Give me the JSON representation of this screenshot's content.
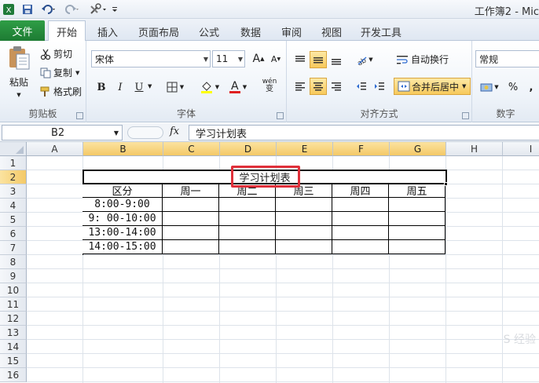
{
  "titlebar": {
    "title": "工作簿2 - Mic"
  },
  "tabs": {
    "file": "文件",
    "items": [
      "开始",
      "插入",
      "页面布局",
      "公式",
      "数据",
      "审阅",
      "视图",
      "开发工具"
    ]
  },
  "ribbon": {
    "clipboard": {
      "label": "剪贴板",
      "paste": "粘贴",
      "cut": "剪切",
      "copy": "复制",
      "painter": "格式刷"
    },
    "font": {
      "label": "字体",
      "name": "宋体",
      "size": "11",
      "bold": "B",
      "italic": "I",
      "underline": "U",
      "grow": "A",
      "shrink": "A",
      "font_color": "A",
      "phonetic": "wén"
    },
    "alignment": {
      "label": "对齐方式",
      "wrap": "自动换行",
      "merge": "合并后居中"
    },
    "number": {
      "label": "数字",
      "format": "常规",
      "percent": "%",
      "comma": ","
    }
  },
  "formula_bar": {
    "name_box": "B2",
    "fx": "fx",
    "content": "学习计划表"
  },
  "columns": [
    "A",
    "B",
    "C",
    "D",
    "E",
    "F",
    "G",
    "H",
    "I"
  ],
  "rows": [
    "1",
    "2",
    "3",
    "4",
    "5",
    "6",
    "7",
    "8",
    "9",
    "10",
    "11",
    "12",
    "13",
    "14",
    "15",
    "16"
  ],
  "table": {
    "title": "学习计划表",
    "headers": [
      "区分",
      "周一",
      "周二",
      "周三",
      "周四",
      "周五"
    ],
    "times": [
      "8:00-9:00",
      "9: 00-10:00",
      "13:00-14:00",
      "14:00-15:00"
    ]
  },
  "watermark": "S 经验"
}
